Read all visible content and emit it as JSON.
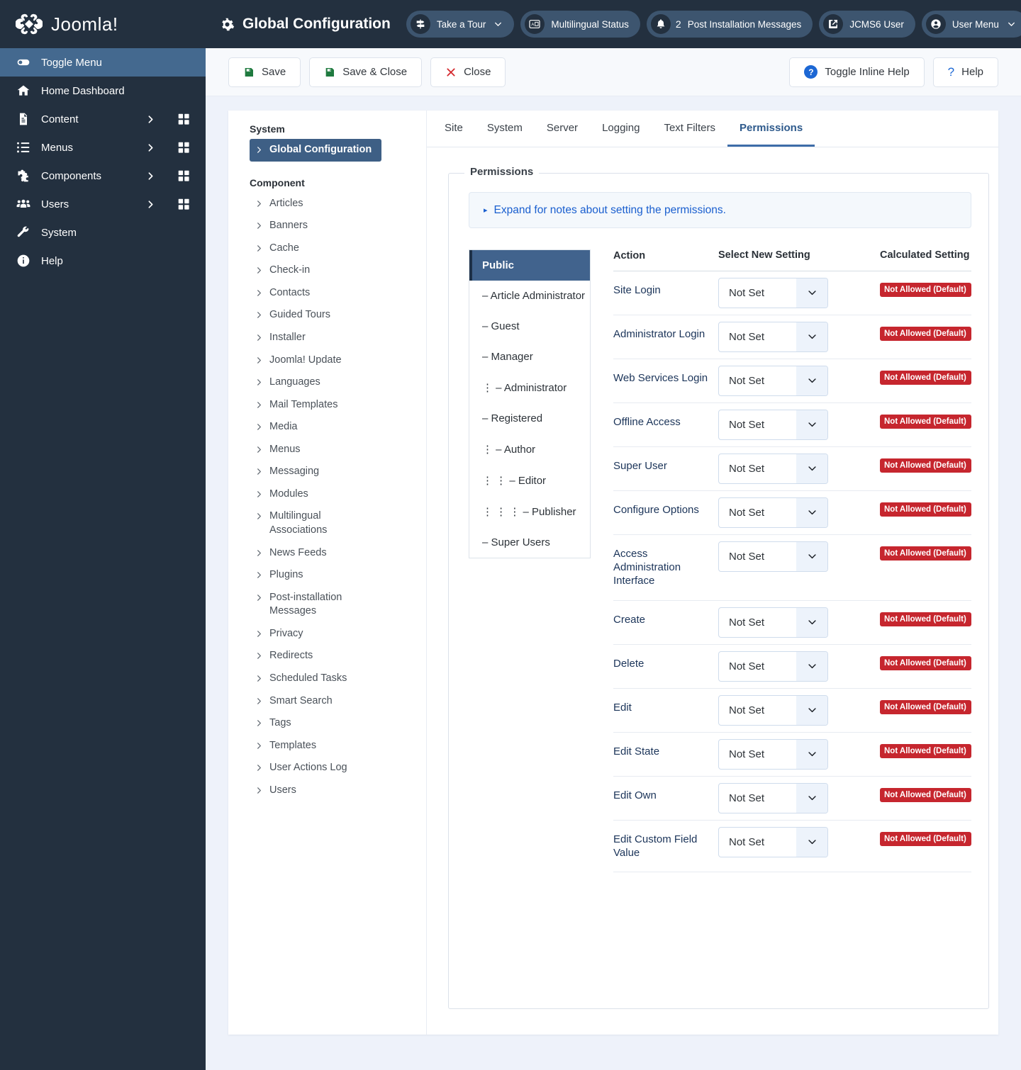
{
  "sidebar": {
    "brand": "Joomla!",
    "items": [
      {
        "label": "Toggle Menu",
        "icon": "toggle-icon",
        "active": true,
        "caret": false,
        "grid": false
      },
      {
        "label": "Home Dashboard",
        "icon": "home-icon",
        "active": false,
        "caret": false,
        "grid": false
      },
      {
        "label": "Content",
        "icon": "document-icon",
        "active": false,
        "caret": true,
        "grid": true
      },
      {
        "label": "Menus",
        "icon": "list-icon",
        "active": false,
        "caret": true,
        "grid": true
      },
      {
        "label": "Components",
        "icon": "puzzle-icon",
        "active": false,
        "caret": true,
        "grid": true
      },
      {
        "label": "Users",
        "icon": "users-icon",
        "active": false,
        "caret": true,
        "grid": true
      },
      {
        "label": "System",
        "icon": "wrench-icon",
        "active": false,
        "caret": false,
        "grid": false
      },
      {
        "label": "Help",
        "icon": "info-icon",
        "active": false,
        "caret": false,
        "grid": false
      }
    ]
  },
  "header": {
    "title": "Global Configuration",
    "title_icon": "gear-icon",
    "pills": [
      {
        "label": "Take a Tour",
        "icon": "signpost-icon",
        "chevron": true,
        "badge": ""
      },
      {
        "label": "Multilingual Status",
        "icon": "translate-icon",
        "chevron": false,
        "badge": ""
      },
      {
        "label": "Post Installation Messages",
        "icon": "bell-icon",
        "chevron": false,
        "badge": "2"
      },
      {
        "label": "JCMS6 User",
        "icon": "external-icon",
        "chevron": false,
        "badge": ""
      },
      {
        "label": "User Menu",
        "icon": "person-icon",
        "chevron": true,
        "badge": ""
      }
    ],
    "overflow": "more-options"
  },
  "toolbar": {
    "left": [
      {
        "label": "Save",
        "icon": "save-icon",
        "color": "#1f7a3f"
      },
      {
        "label": "Save & Close",
        "icon": "save-icon",
        "color": "#1f7a3f"
      },
      {
        "label": "Close",
        "icon": "x-icon",
        "color": "#d4272c"
      }
    ],
    "right": [
      {
        "label": "Toggle Inline Help",
        "icon": "help-filled-icon"
      },
      {
        "label": "Help",
        "icon": "question-icon"
      }
    ]
  },
  "nav_panel": {
    "system_heading": "System",
    "system_items": [
      "Global Configuration"
    ],
    "system_active": "Global Configuration",
    "component_heading": "Component",
    "component_items": [
      "Articles",
      "Banners",
      "Cache",
      "Check-in",
      "Contacts",
      "Guided Tours",
      "Installer",
      "Joomla! Update",
      "Languages",
      "Mail Templates",
      "Media",
      "Menus",
      "Messaging",
      "Modules",
      "Multilingual Associations",
      "News Feeds",
      "Plugins",
      "Post-installation Messages",
      "Privacy",
      "Redirects",
      "Scheduled Tasks",
      "Smart Search",
      "Tags",
      "Templates",
      "User Actions Log",
      "Users"
    ]
  },
  "tabs": [
    {
      "label": "Site",
      "active": false
    },
    {
      "label": "System",
      "active": false
    },
    {
      "label": "Server",
      "active": false
    },
    {
      "label": "Logging",
      "active": false
    },
    {
      "label": "Text Filters",
      "active": false
    },
    {
      "label": "Permissions",
      "active": true
    }
  ],
  "permissions": {
    "legend": "Permissions",
    "notice": "Expand for notes about setting the permissions.",
    "notice_marker": "▸",
    "groups": [
      {
        "label": "Public",
        "indent": 0,
        "active": true
      },
      {
        "label": "– Article Administrator",
        "indent": 0,
        "active": false
      },
      {
        "label": "– Guest",
        "indent": 0,
        "active": false
      },
      {
        "label": "– Manager",
        "indent": 0,
        "active": false
      },
      {
        "label": "⋮  – Administrator",
        "indent": 1,
        "active": false
      },
      {
        "label": "– Registered",
        "indent": 0,
        "active": false
      },
      {
        "label": "⋮  – Author",
        "indent": 1,
        "active": false
      },
      {
        "label": "⋮  ⋮  – Editor",
        "indent": 2,
        "active": false
      },
      {
        "label": "⋮  ⋮  ⋮  – Publisher",
        "indent": 3,
        "active": false
      },
      {
        "label": "– Super Users",
        "indent": 0,
        "active": false
      }
    ],
    "columns": [
      "Action",
      "Select New Setting",
      "Calculated Setting"
    ],
    "select_value": "Not Set",
    "calculated_value": "Not Allowed (Default)",
    "calculated_color": "#c6262e",
    "rows": [
      {
        "action": "Site Login",
        "setting": "Not Set",
        "calculated": "Not Allowed (Default)"
      },
      {
        "action": "Administrator Login",
        "setting": "Not Set",
        "calculated": "Not Allowed (Default)"
      },
      {
        "action": "Web Services Login",
        "setting": "Not Set",
        "calculated": "Not Allowed (Default)"
      },
      {
        "action": "Offline Access",
        "setting": "Not Set",
        "calculated": "Not Allowed (Default)"
      },
      {
        "action": "Super User",
        "setting": "Not Set",
        "calculated": "Not Allowed (Default)"
      },
      {
        "action": "Configure Options",
        "setting": "Not Set",
        "calculated": "Not Allowed (Default)"
      },
      {
        "action": "Access Administration Interface",
        "setting": "Not Set",
        "calculated": "Not Allowed (Default)"
      },
      {
        "action": "Create",
        "setting": "Not Set",
        "calculated": "Not Allowed (Default)"
      },
      {
        "action": "Delete",
        "setting": "Not Set",
        "calculated": "Not Allowed (Default)"
      },
      {
        "action": "Edit",
        "setting": "Not Set",
        "calculated": "Not Allowed (Default)"
      },
      {
        "action": "Edit State",
        "setting": "Not Set",
        "calculated": "Not Allowed (Default)"
      },
      {
        "action": "Edit Own",
        "setting": "Not Set",
        "calculated": "Not Allowed (Default)"
      },
      {
        "action": "Edit Custom Field Value",
        "setting": "Not Set",
        "calculated": "Not Allowed (Default)"
      }
    ]
  }
}
